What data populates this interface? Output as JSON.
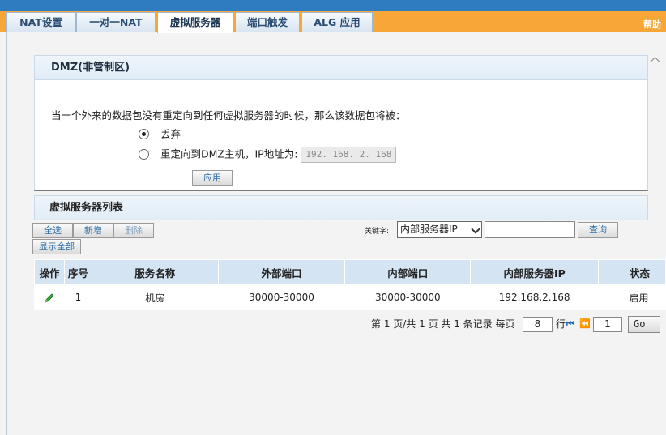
{
  "tabs": [
    {
      "label": "NAT设置"
    },
    {
      "label": "一对一NAT"
    },
    {
      "label": "虚拟服务器"
    },
    {
      "label": "端口触发"
    },
    {
      "label": "ALG 应用"
    }
  ],
  "help_label": "帮助",
  "dmz": {
    "title": "DMZ(非管制区)",
    "description": "当一个外来的数据包没有重定向到任何虚拟服务器的时候，那么该数据包将被：",
    "option_discard": "丢弃",
    "option_redirect": "重定向到DMZ主机，IP地址为:",
    "ip_value": "192. 168. 2. 168",
    "apply_label": "应用",
    "selected": "discard"
  },
  "vs_list": {
    "title": "虚拟服务器列表",
    "select_all": "全选",
    "add": "新增",
    "delete": "删除",
    "show_all": "显示全部",
    "keyword_label": "关键字:",
    "keyword_option": "内部服务器IP",
    "keyword_value": "",
    "search": "查询"
  },
  "table": {
    "headers": [
      "操作",
      "序号",
      "服务名称",
      "外部端口",
      "内部端口",
      "内部服务器IP",
      "状态"
    ],
    "rows": [
      {
        "index": "1",
        "name": "机房",
        "ext_port": "30000-30000",
        "int_port": "30000-30000",
        "server_ip": "192.168.2.168",
        "status": "启用"
      }
    ]
  },
  "pager": {
    "text_before": "第 1 页/共 1 页 共 1 条记录 每页",
    "per_page": "8",
    "rows_label": "行",
    "page_input": "1",
    "go_label": "Go"
  },
  "colors": {
    "topbar": "#2f7cc0",
    "tabstrip": "#f7a638",
    "header": "#d5e4f2",
    "link": "#2f6ea8"
  }
}
